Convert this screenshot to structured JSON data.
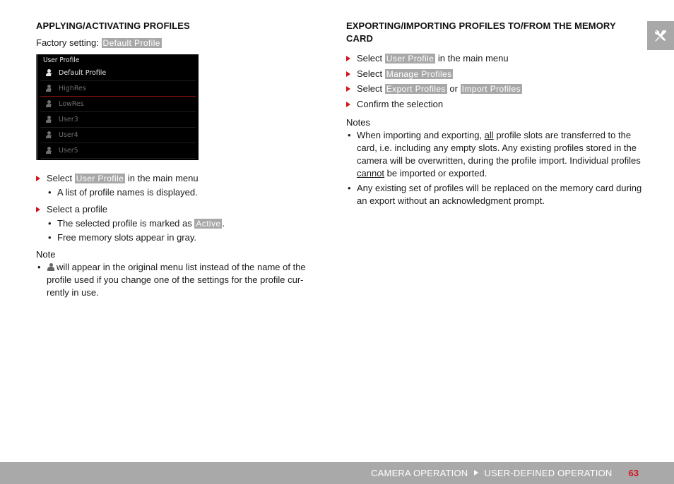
{
  "left": {
    "heading": "APPLYING/ACTIVATING PROFILES",
    "factory_label": "Factory setting:",
    "factory_value": "Default Profile",
    "screen": {
      "title": "User Profile",
      "rows": [
        {
          "label": "Default Profile",
          "badge": "S",
          "state": "active"
        },
        {
          "label": "HighRes",
          "badge": "1",
          "state": "inactive"
        },
        {
          "label": "LowRes",
          "badge": "2",
          "state": "inactive"
        },
        {
          "label": "User3",
          "badge": "3",
          "state": "inactive"
        },
        {
          "label": "User4",
          "badge": "4",
          "state": "inactive"
        },
        {
          "label": "User5",
          "badge": "5",
          "state": "inactive"
        }
      ]
    },
    "steps": [
      {
        "pre": "Select",
        "tag": "User Profile",
        "post": "in the main menu",
        "sub": [
          "A list of profile names is displayed."
        ]
      },
      {
        "pre": "Select a profile",
        "sub_marked_pre": "The selected profile is marked as",
        "sub_marked_tag": "Active",
        "sub_marked_post": ".",
        "sub2": "Free memory slots appear in gray."
      }
    ],
    "note_heading": "Note",
    "note_text": "will appear in the original menu list instead of the name of the profile used if you change one of the settings for the profile cur-rently in use."
  },
  "right": {
    "heading": "EXPORTING/IMPORTING PROFILES TO/FROM THE MEMORY CARD",
    "steps": [
      {
        "pre": "Select",
        "tag": "User Profile",
        "post": "in the main menu"
      },
      {
        "pre": "Select",
        "tag": "Manage Profiles"
      },
      {
        "pre": "Select",
        "tag": "Export Profiles",
        "mid": "or",
        "tag2": "Import Profiles"
      },
      {
        "pre": "Confirm the selection"
      }
    ],
    "notes_heading": "Notes",
    "notes": [
      {
        "a": "When importing and exporting,",
        "u1": "all",
        "b": "profile slots are transferred to the card, i.e. including any empty slots. Any existing profiles stored in the camera will be overwritten, during the profile import. Individual profiles",
        "u2": "cannot",
        "c": "be imported or exported."
      },
      {
        "a": "Any existing set of profiles will be replaced on the memory card during an export without an acknowledgment prompt."
      }
    ]
  },
  "side_tab": {
    "icon": "tools-icon"
  },
  "footer": {
    "section": "CAMERA OPERATION",
    "subsection": "USER-DEFINED OPERATION",
    "page_number": "63"
  },
  "colors": {
    "accent": "#d3141d",
    "tag_bg": "#a8a8a8",
    "footer_bg": "#a9a9a9"
  }
}
